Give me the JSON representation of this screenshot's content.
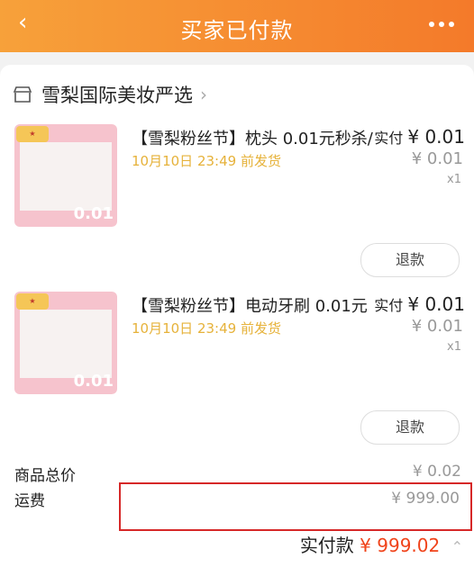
{
  "header": {
    "back_icon": "chevron-left-icon",
    "title": "买家已付款",
    "more_icon": "more-dots-icon"
  },
  "shop": {
    "name": "雪梨国际美妆严选",
    "icon": "store-icon"
  },
  "items": [
    {
      "name": "【雪梨粉丝节】枕头 0.01元秒杀/",
      "date": "10月10日 23:49 前发货",
      "paid_label": "实付",
      "paid_value": "¥ 0.01",
      "original_value": "¥ 0.01",
      "qty": "x1",
      "refund_label": "退款",
      "thumb_price": "0.01"
    },
    {
      "name": "【雪梨粉丝节】电动牙刷 0.01元",
      "date": "10月10日 23:49 前发货",
      "paid_label": "实付",
      "paid_value": "¥ 0.01",
      "original_value": "¥ 0.01",
      "qty": "x1",
      "refund_label": "退款",
      "thumb_price": "0.01"
    }
  ],
  "summary": {
    "goods_label": "商品总价",
    "goods_value": "¥ 0.02",
    "shipping_label": "运费",
    "shipping_value": "¥ 999.00",
    "total_label": "实付款",
    "total_value": "¥ 999.02"
  },
  "colors": {
    "header_start": "#f7a13a",
    "header_end": "#f47a2a",
    "price_orange": "#f0431a",
    "date_yellow": "#e6b23a",
    "highlight_red": "#d62828"
  }
}
